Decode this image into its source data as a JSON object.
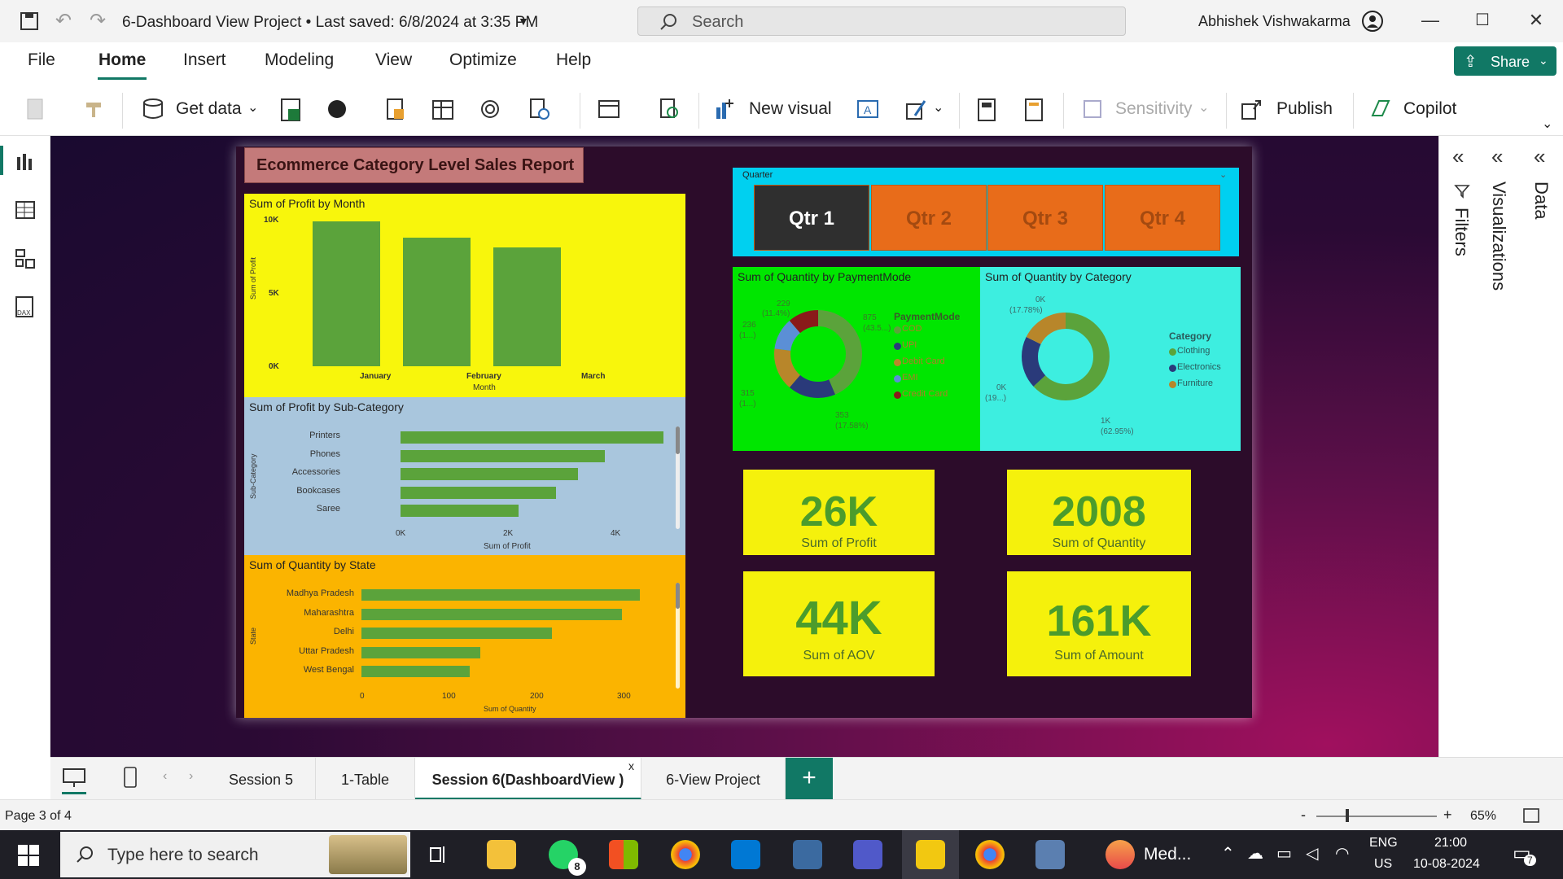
{
  "window": {
    "title": "6-Dashboard View Project • Last saved: 6/8/2024 at 3:35 PM",
    "search_placeholder": "Search",
    "user": "Abhishek Vishwakarma"
  },
  "menu": [
    "File",
    "Home",
    "Insert",
    "Modeling",
    "View",
    "Optimize",
    "Help"
  ],
  "share_label": "Share",
  "ribbon": {
    "get_data": "Get data",
    "new_visual": "New visual",
    "sensitivity": "Sensitivity",
    "publish": "Publish",
    "copilot": "Copilot"
  },
  "panes": {
    "filters": "Filters",
    "visualizations": "Visualizations",
    "data": "Data"
  },
  "report": {
    "title": "Ecommerce Category Level Sales Report",
    "profit_by_month": {
      "title": "Sum of Profit by Month",
      "ylabel": "Sum of Profit",
      "xlabel": "Month",
      "ticks": [
        "10K",
        "5K",
        "0K"
      ],
      "categories": [
        "January",
        "February",
        "March"
      ]
    },
    "profit_by_subcat": {
      "title": "Sum of Profit by Sub-Category",
      "ylabel": "Sub-Category",
      "xlabel": "Sum of Profit",
      "ticks": [
        "0K",
        "2K",
        "4K"
      ],
      "categories": [
        "Printers",
        "Phones",
        "Accessories",
        "Bookcases",
        "Saree"
      ]
    },
    "qty_by_state": {
      "title": "Sum of Quantity by State",
      "ylabel": "State",
      "xlabel": "Sum of Quantity",
      "ticks": [
        "0",
        "100",
        "200",
        "300"
      ],
      "categories": [
        "Madhya Pradesh",
        "Maharashtra",
        "Delhi",
        "Uttar Pradesh",
        "West Bengal"
      ]
    },
    "quarter": {
      "label": "Quarter",
      "options": [
        "Qtr 1",
        "Qtr 2",
        "Qtr 3",
        "Qtr 4"
      ],
      "selected": "Qtr 1"
    },
    "qty_by_payment": {
      "title": "Sum of Quantity by PaymentMode",
      "legend_title": "PaymentMode",
      "legend": [
        "COD",
        "UPI",
        "Debit Card",
        "EMI",
        "Credit Card"
      ],
      "labels": [
        "229",
        "(11.4%)",
        "236",
        "(1...)",
        "875",
        "(43.5...)",
        "315",
        "(1...)",
        "353",
        "(17.58%)"
      ]
    },
    "qty_by_category": {
      "title": "Sum of Quantity by Category",
      "legend_title": "Category",
      "legend": [
        "Clothing",
        "Electronics",
        "Furniture"
      ],
      "labels": [
        "0K",
        "(17.78%)",
        "0K",
        "(19...)",
        "1K",
        "(62.95%)"
      ]
    },
    "kpis": [
      {
        "value": "26K",
        "label": "Sum of Profit"
      },
      {
        "value": "2008",
        "label": "Sum of Quantity"
      },
      {
        "value": "44K",
        "label": "Sum of AOV"
      },
      {
        "value": "161K",
        "label": "Sum of Amount"
      }
    ]
  },
  "chart_data": [
    {
      "type": "bar",
      "title": "Sum of Profit by Month",
      "categories": [
        "January",
        "February",
        "March"
      ],
      "values": [
        9900,
        8800,
        8100
      ],
      "xlabel": "Month",
      "ylabel": "Sum of Profit",
      "ylim": [
        0,
        10000
      ]
    },
    {
      "type": "bar",
      "title": "Sum of Profit by Sub-Category",
      "categories": [
        "Printers",
        "Phones",
        "Accessories",
        "Bookcases",
        "Saree"
      ],
      "values": [
        4900,
        3800,
        3300,
        2900,
        2200
      ],
      "xlabel": "Sum of Profit",
      "ylabel": "Sub-Category",
      "xlim": [
        0,
        5000
      ]
    },
    {
      "type": "bar",
      "title": "Sum of Quantity by State",
      "categories": [
        "Madhya Pradesh",
        "Maharashtra",
        "Delhi",
        "Uttar Pradesh",
        "West Bengal"
      ],
      "values": [
        328,
        307,
        225,
        140,
        128
      ],
      "xlabel": "Sum of Quantity",
      "ylabel": "State",
      "xlim": [
        0,
        340
      ]
    },
    {
      "type": "pie",
      "title": "Sum of Quantity by PaymentMode",
      "categories": [
        "COD",
        "UPI",
        "Debit Card",
        "EMI",
        "Credit Card"
      ],
      "values": [
        875,
        353,
        315,
        236,
        229
      ],
      "colors": [
        "#5ba33b",
        "#2a3a7a",
        "#b8862a",
        "#5b8fd6",
        "#8a1a1a"
      ]
    },
    {
      "type": "pie",
      "title": "Sum of Quantity by Category",
      "categories": [
        "Clothing",
        "Electronics",
        "Furniture"
      ],
      "values": [
        62.95,
        19.27,
        17.78
      ],
      "colors": [
        "#5ba33b",
        "#2a3a7a",
        "#b8862a"
      ]
    }
  ],
  "page_tabs": [
    "Session 5",
    "1-Table",
    "Session 6(DashboardView )",
    "6-View Project"
  ],
  "active_tab": "Session 6(DashboardView )",
  "status": {
    "page": "Page 3 of 4",
    "zoom": "65%"
  },
  "taskbar": {
    "search_placeholder": "Type here to search",
    "running_app": "Med...",
    "lang1": "ENG",
    "lang2": "US",
    "time": "21:00",
    "date": "10-08-2024",
    "whatsapp_badge": "8",
    "notif_badge": "7"
  }
}
